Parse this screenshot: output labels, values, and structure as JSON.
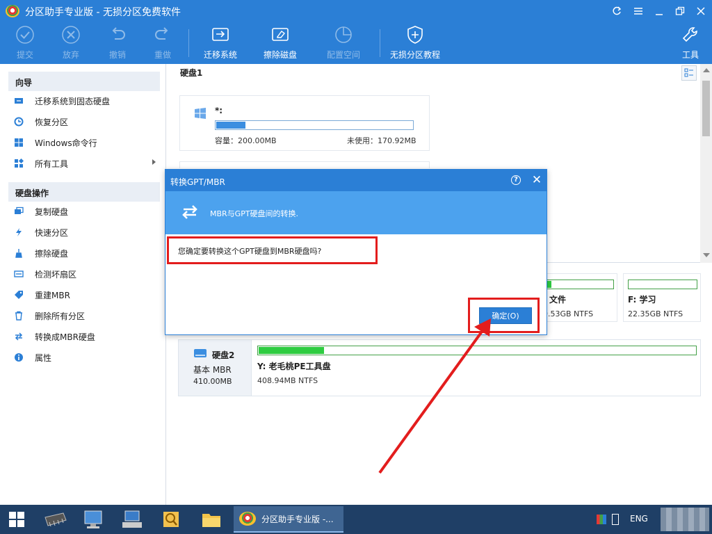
{
  "window": {
    "title": "分区助手专业版 - 无损分区免费软件",
    "controls": [
      "refresh-icon",
      "menu-icon",
      "minimize-icon",
      "restore-icon",
      "close-icon"
    ]
  },
  "toolbar": {
    "submit": "提交",
    "discard": "放弃",
    "undo": "撤销",
    "redo": "重做",
    "migrate_os": "迁移系统",
    "wipe_disk": "擦除磁盘",
    "allocate_space": "配置空间",
    "tutorial": "无损分区教程",
    "tools": "工具"
  },
  "sidebar": {
    "wizard_title": "向导",
    "wizard_items": [
      "迁移系统到固态硬盘",
      "恢复分区",
      "Windows命令行",
      "所有工具"
    ],
    "disk_ops_title": "硬盘操作",
    "disk_ops_items": [
      "复制硬盘",
      "快速分区",
      "擦除硬盘",
      "检测坏扇区",
      "重建MBR",
      "删除所有分区",
      "转换成MBR硬盘",
      "属性"
    ]
  },
  "disk1": {
    "label": "硬盘1",
    "partition": {
      "name": "*:",
      "capacity": "容量：200.00MB",
      "unused": "未使用：170.92MB",
      "used_fraction": 0.15
    }
  },
  "lower_partitions": [
    {
      "name": ": 文件",
      "size": "9.53GB NTFS",
      "used_fraction": 0.1
    },
    {
      "name": "F: 学习",
      "size": "22.35GB NTFS",
      "used_fraction": 0.0
    }
  ],
  "disk2": {
    "label": "硬盘2",
    "type": "基本 MBR",
    "size": "410.00MB",
    "partition": {
      "name": "Y: 老毛桃PE工具盘",
      "size": "408.94MB NTFS",
      "used_fraction": 0.15
    }
  },
  "dialog": {
    "title": "转换GPT/MBR",
    "banner_text": "MBR与GPT硬盘间的转换.",
    "question": "您确定要转换这个GPT硬盘到MBR硬盘吗?",
    "ok_label": "确定(O)"
  },
  "taskbar": {
    "app_label": "分区助手专业版 -...",
    "language": "ENG"
  },
  "colors": {
    "accent": "#2b7fd6",
    "highlight": "#e31d1d",
    "used_bar_blue": "#3b8ee0",
    "used_bar_green": "#2ecc40"
  }
}
